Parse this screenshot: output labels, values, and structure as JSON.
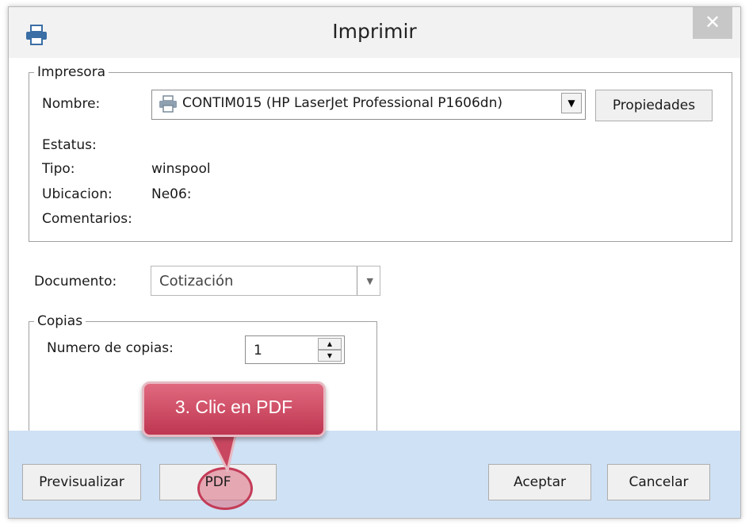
{
  "window": {
    "title": "Imprimir",
    "close_symbol": "✕"
  },
  "printer_group": {
    "legend": "Impresora",
    "name_label": "Nombre:",
    "name_value": "CONTIM015 (HP LaserJet Professional P1606dn)",
    "properties_button": "Propiedades",
    "status_label": "Estatus:",
    "status_value": "",
    "type_label": "Tipo:",
    "type_value": "winspool",
    "location_label": "Ubicacion:",
    "location_value": "Ne06:",
    "comments_label": "Comentarios:",
    "comments_value": ""
  },
  "document": {
    "label": "Documento:",
    "value": "Cotización"
  },
  "copies_group": {
    "legend": "Copias",
    "count_label": "Numero de copias:",
    "count_value": "1"
  },
  "callout": {
    "text": "3. Clic en PDF",
    "color": "#c94660"
  },
  "footer": {
    "preview_button": "Previsualizar",
    "preview_access_key": "v",
    "pdf_button": "PDF",
    "accept_button": "Aceptar",
    "cancel_button": "Cancelar"
  },
  "colors": {
    "footer_bg": "#cfe1f4",
    "title_bg": "#f2f2f2"
  }
}
